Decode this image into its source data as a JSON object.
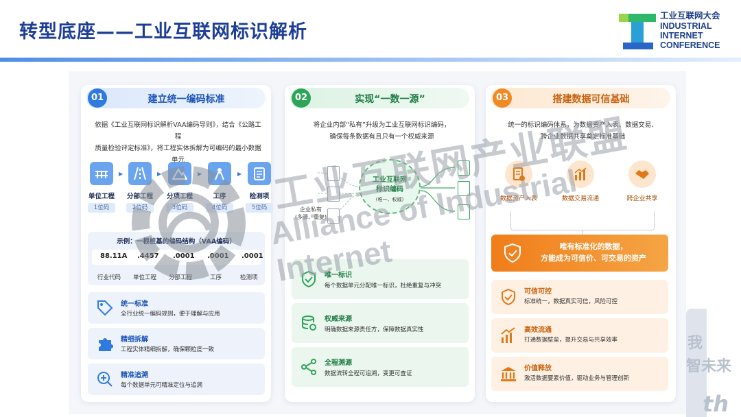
{
  "header": {
    "title": "转型底座——工业互联网标识解析",
    "logo": {
      "cn": "工业互联网大会",
      "en1": "INDUSTRIAL",
      "en2": "INTERNET",
      "en3": "CONFERENCE"
    }
  },
  "watermark": {
    "line1": "工业互联网产业联盟",
    "line2": "Alliance of Industrial Internet"
  },
  "right_deco": {
    "t1": "我",
    "t2": "智未来",
    "t3": "th"
  },
  "panels": [
    {
      "num": "01",
      "title": "建立统一编码标准",
      "desc_line1": "依据《工业互联网标识解析VAA编码导则》，结合《公路工程",
      "desc_line2": "质量检验评定标准》，将工程实体拆解为可编码的最小数据单元",
      "steps": [
        {
          "label": "单位工程",
          "code": "1位码",
          "icon": "bridge-icon"
        },
        {
          "label": "分部工程",
          "code": "2位码",
          "icon": "road-icon"
        },
        {
          "label": "分项工程",
          "code": "3位码",
          "icon": "mountain-icon"
        },
        {
          "label": "工序",
          "code": "4位码",
          "icon": "worker-icon"
        },
        {
          "label": "检测项",
          "code": "5位码",
          "icon": "checklist-icon"
        }
      ],
      "example": {
        "title": "示例：一根桩基的编码结构（VAA编码）",
        "codes": [
          "88.11A",
          ".4457",
          ".0001",
          ".0001",
          ".0001"
        ],
        "labels": [
          "行业代码",
          "单位工程",
          "分部工程",
          "工序",
          "检测项"
        ]
      },
      "features": [
        {
          "title": "统一标准",
          "desc": "全行业统一编码规则，便于理解与应用",
          "icon": "tag-icon"
        },
        {
          "title": "精细拆解",
          "desc": "工程实体精细拆解，确保颗粒度一致",
          "icon": "puzzle-icon"
        },
        {
          "title": "精准追溯",
          "desc": "每个数据单元可精准定位与追溯",
          "icon": "zoom-icon"
        }
      ]
    },
    {
      "num": "02",
      "title": "实现“一数一源”",
      "desc_line1": "将企业内部“私有”升级为工业互联网标识编码，",
      "desc_line2": "确保每条数据有且只有一个权威来源",
      "center_title1": "工业互联网",
      "center_title2": "标识编码",
      "center_sub": "(唯一、权威)",
      "private_label1": "企业私有",
      "private_label2": "(多源、重复)",
      "features": [
        {
          "title": "唯一标识",
          "desc": "每个数据单元分配唯一标识，杜绝重复与冲突",
          "icon": "shield-check-icon"
        },
        {
          "title": "权威来源",
          "desc": "明确数据来源责任方，保障数据真实性",
          "icon": "database-icon"
        },
        {
          "title": "全程溯源",
          "desc": "数据流转全程可追溯，变更可查证",
          "icon": "share-icon"
        }
      ]
    },
    {
      "num": "03",
      "title": "搭建数据可信基础",
      "desc_line1": "统一的标识编码体系，为数据资产入表、数据交易、",
      "desc_line2": "跨企业数据共享奠定标准基础",
      "icons": [
        {
          "label": "数据资产入表",
          "icon": "document-icon"
        },
        {
          "label": "数据交易流通",
          "icon": "bar-chart-icon"
        },
        {
          "label": "跨企业共享",
          "icon": "handshake-icon"
        }
      ],
      "banner_line1": "唯有标准化的数据，",
      "banner_line2": "方能成为可信价、可交易的资产",
      "features": [
        {
          "title": "可信可控",
          "desc": "标准统一，数据真实可信，风险可控",
          "icon": "shield-check-icon"
        },
        {
          "title": "高效流通",
          "desc": "打通数据壁垒，提升交易与共享效率",
          "icon": "growth-chart-icon"
        },
        {
          "title": "价值释放",
          "desc": "激活数据要素价值，驱动业务与管理创新",
          "icon": "bank-icon"
        }
      ]
    }
  ]
}
